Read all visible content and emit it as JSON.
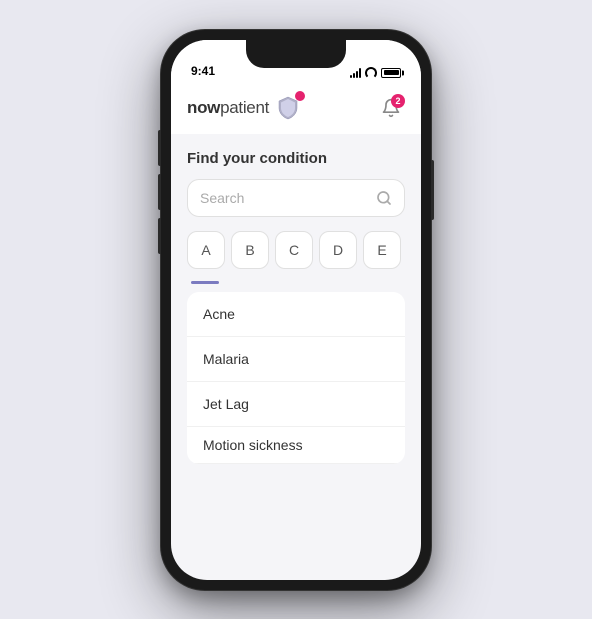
{
  "phone": {
    "status_bar": {
      "time": "9:41"
    },
    "header": {
      "logo_text_bold": "now",
      "logo_text_normal": "patient",
      "notification_count": "2"
    },
    "content": {
      "find_condition_title": "Find your condition",
      "search_placeholder": "Search",
      "letter_filters": [
        "A",
        "B",
        "C",
        "D",
        "E"
      ],
      "conditions": [
        "Acne",
        "Malaria",
        "Jet Lag",
        "Motion sickness"
      ]
    }
  }
}
